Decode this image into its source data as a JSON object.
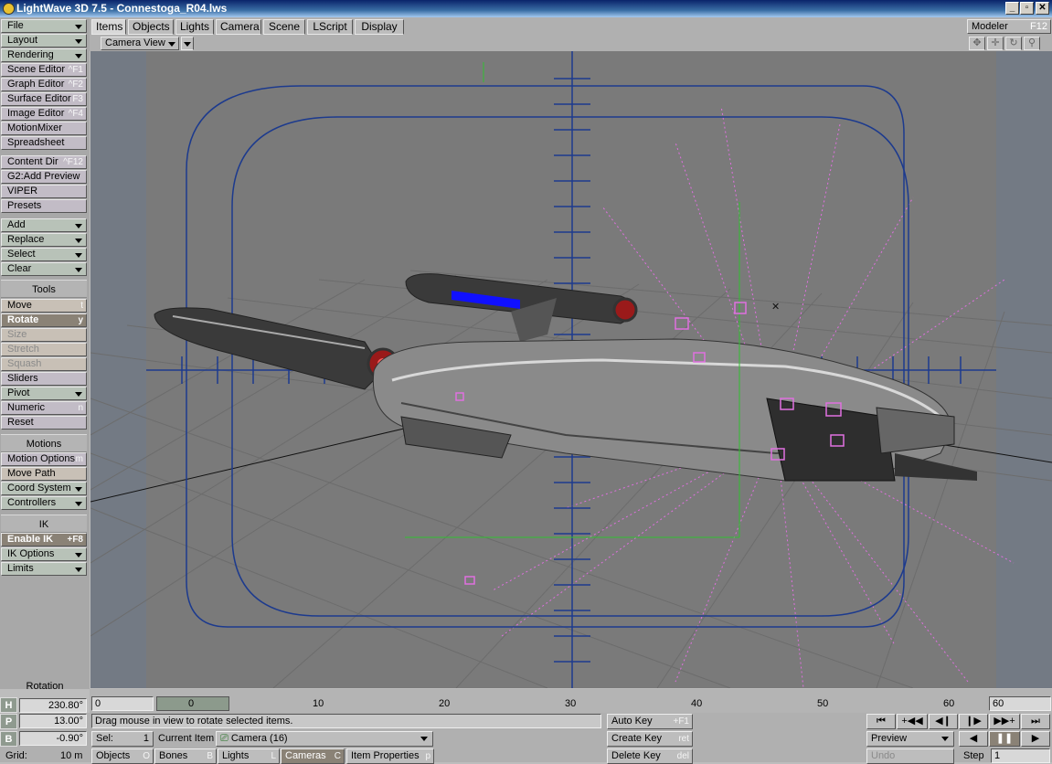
{
  "window": {
    "title": "LightWave 3D 7.5 - Connestoga_R04.lws",
    "minimize": "_",
    "maximize": "▫",
    "close": "✕"
  },
  "sidebar": {
    "file": "File",
    "layout": "Layout",
    "rendering": "Rendering",
    "scene_editor": "Scene Editor",
    "scene_editor_sc": "^F1",
    "graph_editor": "Graph Editor",
    "graph_editor_sc": "^F2",
    "surface_editor": "Surface Editor",
    "surface_editor_sc": "F3",
    "image_editor": "Image Editor",
    "image_editor_sc": "^F4",
    "motion_mixer": "MotionMixer",
    "spreadsheet": "Spreadsheet",
    "content_dir": "Content Dir",
    "content_dir_sc": "^F12",
    "g2_add_preview": "G2:Add Preview",
    "viper": "VIPER",
    "presets": "Presets",
    "add": "Add",
    "replace": "Replace",
    "select": "Select",
    "clear": "Clear",
    "tools_header": "Tools",
    "move": "Move",
    "move_sc": "t",
    "rotate": "Rotate",
    "rotate_sc": "y",
    "size": "Size",
    "stretch": "Stretch",
    "squash": "Squash",
    "sliders": "Sliders",
    "pivot": "Pivot",
    "numeric": "Numeric",
    "numeric_sc": "n",
    "reset": "Reset",
    "motions_header": "Motions",
    "motion_options": "Motion Options",
    "motion_options_sc": "m",
    "move_path": "Move Path",
    "coord_system": "Coord System",
    "controllers": "Controllers",
    "ik_header": "IK",
    "enable_ik": "Enable IK",
    "enable_ik_sc": "+F8",
    "ik_options": "IK Options",
    "limits": "Limits"
  },
  "tabs": [
    "Items",
    "Objects",
    "Lights",
    "Camera",
    "Scene",
    "LScript",
    "Display"
  ],
  "modeler": {
    "label": "Modeler",
    "shortcut": "F12"
  },
  "viewport": {
    "view_label": "Camera View"
  },
  "timeline": {
    "start": "0",
    "end": "60",
    "current": "0",
    "ticks": [
      "0",
      "10",
      "20",
      "30",
      "40",
      "50",
      "60"
    ]
  },
  "rotation": {
    "label": "Rotation",
    "h_label": "H",
    "h_value": "230.80°",
    "p_label": "P",
    "p_value": "13.00°",
    "b_label": "B",
    "b_value": "-0.90°"
  },
  "grid": {
    "label": "Grid:",
    "value": "10 m"
  },
  "status": {
    "message": "Drag mouse in view to rotate selected items."
  },
  "sel": {
    "label": "Sel:",
    "value": "1"
  },
  "current_item": {
    "label": "Current Item",
    "value": "Camera (16)"
  },
  "item_tabs": {
    "objects": "Objects",
    "objects_sc": "O",
    "bones": "Bones",
    "bones_sc": "B",
    "lights": "Lights",
    "lights_sc": "L",
    "cameras": "Cameras",
    "cameras_sc": "C",
    "item_properties": "Item Properties",
    "item_properties_sc": "p"
  },
  "keys": {
    "auto_key": "Auto Key",
    "auto_key_sc": "+F1",
    "create_key": "Create Key",
    "create_key_sc": "ret",
    "delete_key": "Delete Key",
    "delete_key_sc": "del"
  },
  "playback": {
    "preview": "Preview",
    "undo": "Undo",
    "step_label": "Step",
    "step_value": "1"
  },
  "colors": {
    "viewport_bg": "#787878",
    "safe_area": "#1c3a8e",
    "selection": "#e070e0",
    "pivot_green": "#30c030"
  }
}
